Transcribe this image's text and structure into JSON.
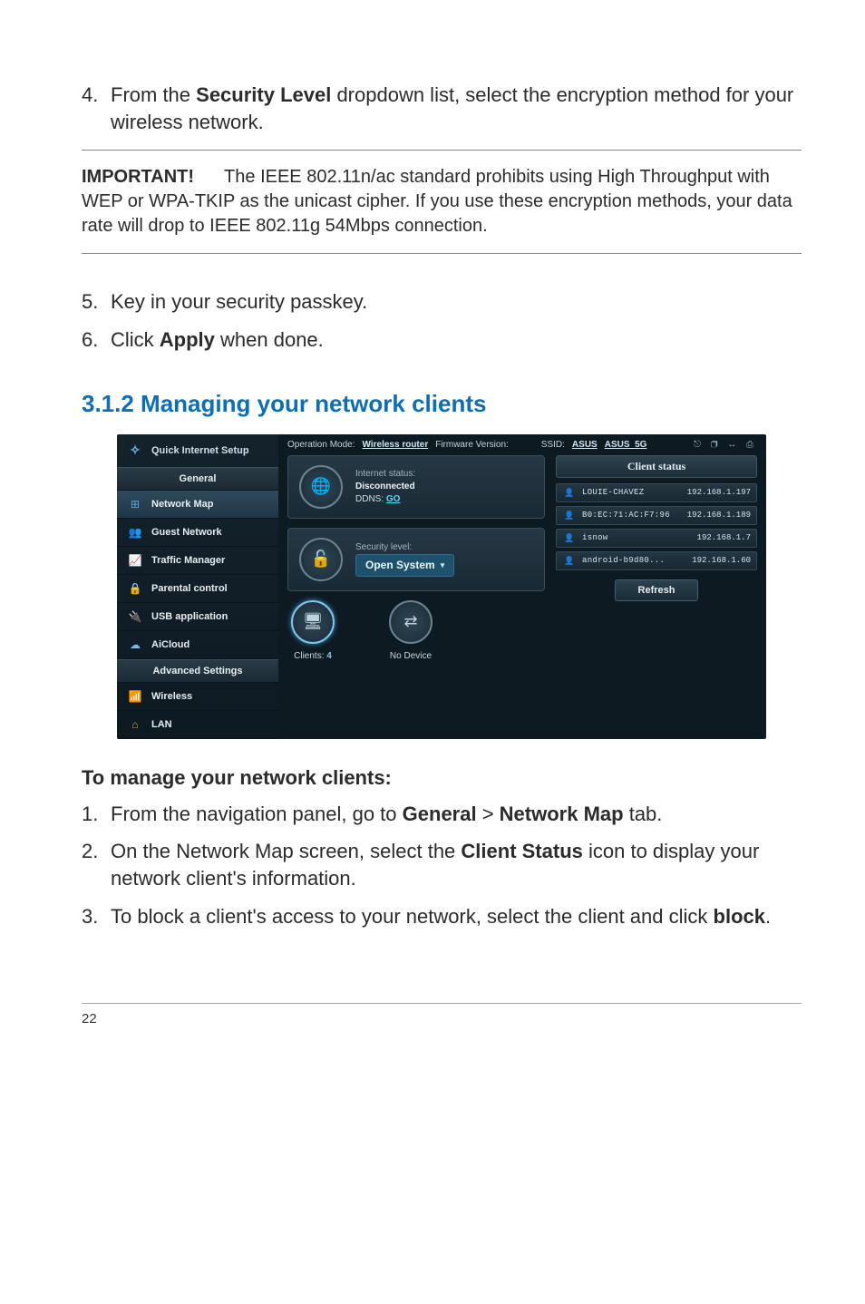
{
  "step4": {
    "num": "4.",
    "pre": "From the ",
    "bold": "Security Level",
    "post": " dropdown list, select the encryption method for your wireless network."
  },
  "important": {
    "label": "IMPORTANT!",
    "text": " The IEEE 802.11n/ac standard prohibits using High Throughput with WEP or WPA-TKIP as the unicast cipher. If you use these encryption methods, your data rate will drop to IEEE 802.11g 54Mbps connection."
  },
  "step5": {
    "num": "5.",
    "text": "Key in your security passkey."
  },
  "step6": {
    "num": "6.",
    "pre": "Click ",
    "bold": "Apply",
    "post": " when done."
  },
  "section_heading": "3.1.2 Managing your network clients",
  "router": {
    "top": {
      "quick": "Quick Internet Setup",
      "op_label": "Operation Mode:",
      "op_value": "Wireless router",
      "fw_label": "Firmware Version:",
      "ssid_label": "SSID:",
      "ssid1": "ASUS",
      "ssid2": "ASUS_5G"
    },
    "groups": {
      "general": "General",
      "advanced": "Advanced Settings"
    },
    "sidebar": [
      {
        "icon": "⊞",
        "color": "#59a8d6",
        "label": "Network Map",
        "active": true
      },
      {
        "icon": "👥",
        "color": "#4fa54a",
        "label": "Guest Network"
      },
      {
        "icon": "📈",
        "color": "#3aa0d8",
        "label": "Traffic Manager"
      },
      {
        "icon": "🔒",
        "color": "#e0a528",
        "label": "Parental control"
      },
      {
        "icon": "🔌",
        "color": "#d94a3a",
        "label": "USB application"
      },
      {
        "icon": "☁",
        "color": "#7fb9d9",
        "label": "AiCloud"
      }
    ],
    "sidebar_adv": [
      {
        "icon": "📶",
        "color": "#3aa0d8",
        "label": "Wireless"
      },
      {
        "icon": "⌂",
        "color": "#cfa84a",
        "label": "LAN"
      }
    ],
    "internet": {
      "title": "Internet status:",
      "value": "Disconnected",
      "ddns_label": "DDNS:",
      "ddns_value": "GO"
    },
    "security": {
      "title": "Security level:",
      "value": "Open System"
    },
    "tiles": {
      "clients_label": "Clients:",
      "clients_n": "4",
      "nodevice": "No Device"
    },
    "clients_header": "Client status",
    "clients": [
      {
        "name": "LOUIE-CHAVEZ",
        "ip": "192.168.1.197"
      },
      {
        "name": "B0:EC:71:AC:F7:96",
        "ip": "192.168.1.189"
      },
      {
        "name": "isnow",
        "ip": "192.168.1.7"
      },
      {
        "name": "android-b9d80...",
        "ip": "192.168.1.60"
      }
    ],
    "refresh": "Refresh"
  },
  "subhead": "To manage your network clients:",
  "mstep1": {
    "num": "1.",
    "pre": "From the navigation panel, go to ",
    "b1": "General",
    "gt": " > ",
    "b2": "Network Map",
    "post": " tab."
  },
  "mstep2": {
    "num": "2.",
    "pre": "On the Network Map screen, select the ",
    "b1": "Client Status",
    "post": " icon to display your network client's information."
  },
  "mstep3": {
    "num": "3.",
    "pre": "To block a client's access to your network, select the client and click ",
    "b1": "block",
    "post": "."
  },
  "page_number": "22"
}
